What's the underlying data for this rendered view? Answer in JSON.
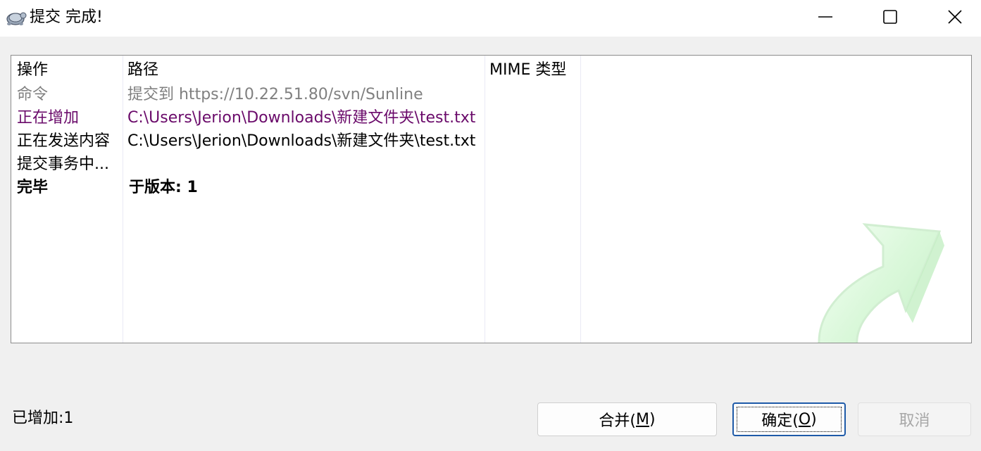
{
  "window": {
    "title": "提交 完成!",
    "controls": {
      "minimize_icon": "minimize-icon",
      "maximize_icon": "maximize-icon",
      "close_icon": "close-icon"
    }
  },
  "list": {
    "columns": [
      "操作",
      "路径",
      "MIME 类型"
    ],
    "rows": [
      {
        "action": "命令",
        "path": "提交到 https://10.22.51.80/svn/Sunline",
        "mime": "",
        "style": "gray"
      },
      {
        "action": "正在增加",
        "path": "C:\\Users\\Jerion\\Downloads\\新建文件夹\\test.txt",
        "mime": "",
        "style": "purple"
      },
      {
        "action": "正在发送内容",
        "path": "C:\\Users\\Jerion\\Downloads\\新建文件夹\\test.txt",
        "mime": "",
        "style": "black"
      },
      {
        "action": "提交事务中...",
        "path": "",
        "mime": "",
        "style": "black"
      },
      {
        "action": "完毕",
        "path": "于版本: 1",
        "mime": "",
        "style": "bold"
      }
    ]
  },
  "status": {
    "text": "已增加:1"
  },
  "buttons": {
    "merge": {
      "label": "合并(",
      "hotkey": "M",
      "suffix": ")"
    },
    "ok": {
      "label": "确定(",
      "hotkey": "O",
      "suffix": ")"
    },
    "cancel": {
      "label": "取消"
    }
  },
  "colors": {
    "gray_row": "#808080",
    "purple_row": "#6a0a6a",
    "default_button_border": "#1e5aa8"
  }
}
